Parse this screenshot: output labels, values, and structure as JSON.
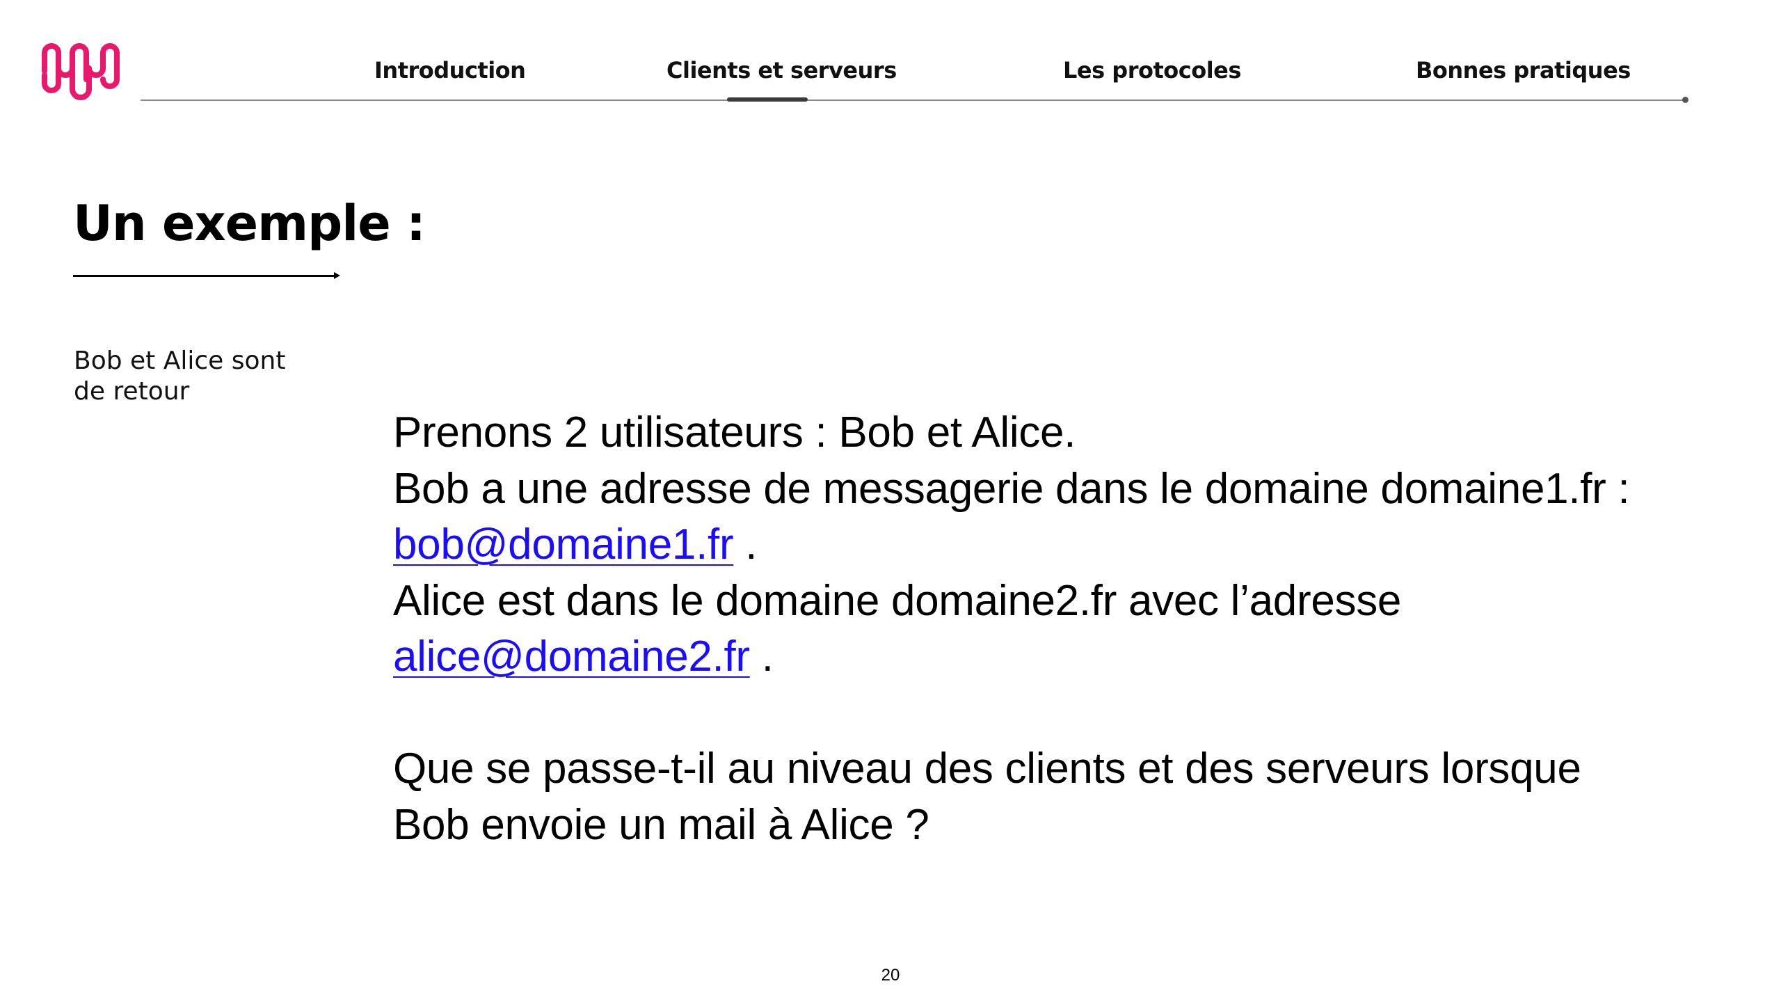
{
  "nav": {
    "items": [
      {
        "label": "Introduction"
      },
      {
        "label": "Clients et serveurs"
      },
      {
        "label": "Les protocoles"
      },
      {
        "label": "Bonnes pratiques"
      }
    ],
    "active_index": 1
  },
  "title": "Un exemple :",
  "side_note": {
    "line1": "Bob et Alice sont",
    "line2": "de retour"
  },
  "body": {
    "line1": "Prenons 2 utilisateurs : Bob et Alice.",
    "line2": "Bob a une adresse de messagerie dans le domaine domaine1.fr :",
    "bob_email": "bob@domaine1.fr",
    "bob_suffix": " .",
    "line4": "Alice est dans le domaine domaine2.fr avec l’adresse",
    "alice_email": "alice@domaine2.fr",
    "alice_suffix": " .",
    "question_line1": "Que se passe-t-il au niveau des clients et des serveurs lorsque",
    "question_line2": "Bob envoie un mail à Alice ?"
  },
  "page_number": "20",
  "colors": {
    "logo": "#e8186d",
    "link": "#1a0dff",
    "text": "#000000",
    "nav_line": "#8a8a8a"
  },
  "icons": {
    "logo": "brand-logo-icon"
  }
}
